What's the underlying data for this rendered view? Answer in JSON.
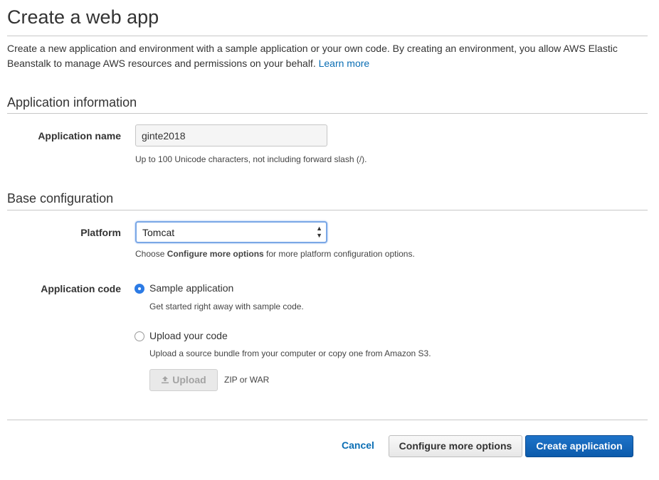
{
  "page": {
    "title": "Create a web app",
    "intro": "Create a new application and environment with a sample application or your own code. By creating an environment, you allow AWS Elastic Beanstalk to manage AWS resources and permissions on your behalf.",
    "learn_more": "Learn more"
  },
  "app_info": {
    "heading": "Application information",
    "name_label": "Application name",
    "name_value": "ginte2018",
    "name_hint": "Up to 100 Unicode characters, not including forward slash (/)."
  },
  "base_config": {
    "heading": "Base configuration",
    "platform_label": "Platform",
    "platform_value": "Tomcat",
    "platform_hint_prefix": "Choose ",
    "platform_hint_bold": "Configure more options",
    "platform_hint_suffix": " for more platform configuration options.",
    "code_label": "Application code",
    "options": [
      {
        "label": "Sample application",
        "hint": "Get started right away with sample code.",
        "checked": true
      },
      {
        "label": "Upload your code",
        "hint": "Upload a source bundle from your computer or copy one from Amazon S3.",
        "checked": false
      }
    ],
    "upload_button": "Upload",
    "upload_note": "ZIP or WAR"
  },
  "footer": {
    "cancel": "Cancel",
    "configure": "Configure more options",
    "create": "Create application"
  },
  "colors": {
    "link": "#0a6eb4",
    "primary": "#0c5bac",
    "radio_checked": "#2c7be5"
  },
  "icons": {
    "upload": "upload-icon",
    "select_arrows": "select-arrows-icon"
  }
}
